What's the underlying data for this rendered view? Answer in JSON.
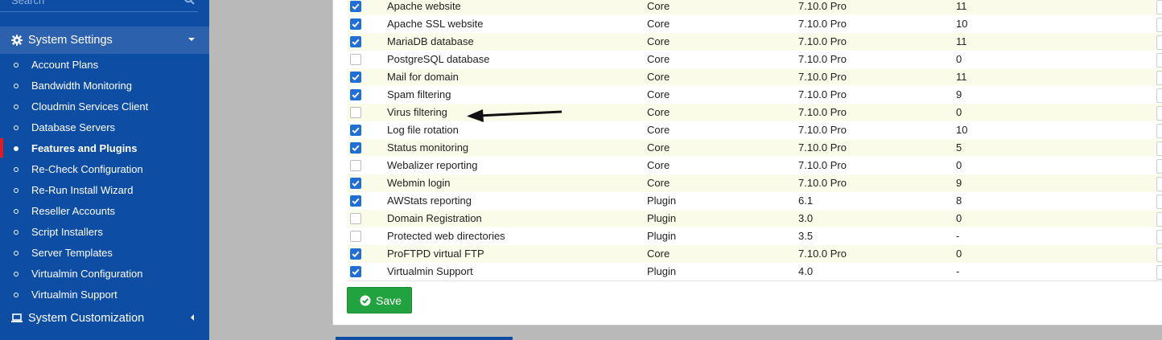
{
  "sidebar": {
    "search_placeholder": "Search",
    "system_settings": "System Settings",
    "items": [
      {
        "label": "Account Plans",
        "active": false
      },
      {
        "label": "Bandwidth Monitoring",
        "active": false
      },
      {
        "label": "Cloudmin Services Client",
        "active": false
      },
      {
        "label": "Database Servers",
        "active": false
      },
      {
        "label": "Features and Plugins",
        "active": true
      },
      {
        "label": "Re-Check Configuration",
        "active": false
      },
      {
        "label": "Re-Run Install Wizard",
        "active": false
      },
      {
        "label": "Reseller Accounts",
        "active": false
      },
      {
        "label": "Script Installers",
        "active": false
      },
      {
        "label": "Server Templates",
        "active": false
      },
      {
        "label": "Virtualmin Configuration",
        "active": false
      },
      {
        "label": "Virtualmin Support",
        "active": false
      }
    ],
    "system_customization": "System Customization"
  },
  "features": {
    "rows": [
      {
        "enabled": true,
        "name": "Apache website",
        "type": "Core",
        "version": "7.10.0 Pro",
        "count": "11"
      },
      {
        "enabled": true,
        "name": "Apache SSL website",
        "type": "Core",
        "version": "7.10.0 Pro",
        "count": "10"
      },
      {
        "enabled": true,
        "name": "MariaDB database",
        "type": "Core",
        "version": "7.10.0 Pro",
        "count": "11"
      },
      {
        "enabled": false,
        "name": "PostgreSQL database",
        "type": "Core",
        "version": "7.10.0 Pro",
        "count": "0"
      },
      {
        "enabled": true,
        "name": "Mail for domain",
        "type": "Core",
        "version": "7.10.0 Pro",
        "count": "11"
      },
      {
        "enabled": true,
        "name": "Spam filtering",
        "type": "Core",
        "version": "7.10.0 Pro",
        "count": "9"
      },
      {
        "enabled": false,
        "name": "Virus filtering",
        "type": "Core",
        "version": "7.10.0 Pro",
        "count": "0"
      },
      {
        "enabled": true,
        "name": "Log file rotation",
        "type": "Core",
        "version": "7.10.0 Pro",
        "count": "10"
      },
      {
        "enabled": true,
        "name": "Status monitoring",
        "type": "Core",
        "version": "7.10.0 Pro",
        "count": "5"
      },
      {
        "enabled": false,
        "name": "Webalizer reporting",
        "type": "Core",
        "version": "7.10.0 Pro",
        "count": "0"
      },
      {
        "enabled": true,
        "name": "Webmin login",
        "type": "Core",
        "version": "7.10.0 Pro",
        "count": "9"
      },
      {
        "enabled": true,
        "name": "AWStats reporting",
        "type": "Plugin",
        "version": "6.1",
        "count": "8"
      },
      {
        "enabled": false,
        "name": "Domain Registration",
        "type": "Plugin",
        "version": "3.0",
        "count": "0"
      },
      {
        "enabled": false,
        "name": "Protected web directories",
        "type": "Plugin",
        "version": "3.5",
        "count": "-"
      },
      {
        "enabled": true,
        "name": "ProFTPD virtual FTP",
        "type": "Core",
        "version": "7.10.0 Pro",
        "count": "0"
      },
      {
        "enabled": true,
        "name": "Virtualmin Support",
        "type": "Plugin",
        "version": "4.0",
        "count": "-"
      }
    ]
  },
  "save_label": "Save",
  "colors": {
    "sidebar_bg": "#0d4da3",
    "sidebar_active_header": "#2c62ad",
    "active_marker": "#e21a1a",
    "checkbox_on": "#1f6fd6",
    "save_button": "#21a33f",
    "row_stripe": "#fbfbe9"
  },
  "icons": {
    "search": "search-icon",
    "settings": "gear-icon",
    "customization": "laptop-icon",
    "save": "check-circle-icon",
    "annotation": "arrow-left-icon"
  }
}
